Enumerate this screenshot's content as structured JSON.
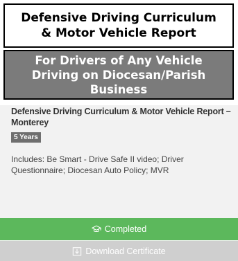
{
  "banner": {
    "title_line1": "Defensive Driving Curriculum",
    "title_line2": "& Motor Vehicle Report",
    "subtitle": "For Drivers of Any Vehicle Driving on Diocesan/Parish Business"
  },
  "course": {
    "title": "Defensive Driving Curriculum & Motor Vehicle Report – Monterey",
    "duration_badge": "5 Years",
    "includes": "Includes: Be Smart - Drive Safe II video; Driver Questionnaire; Diocesan Auto Policy; MVR"
  },
  "actions": {
    "completed_label": "Completed",
    "completed_icon": "graduation-cap-icon",
    "download_label": "Download Certificate",
    "download_icon": "download-icon"
  },
  "colors": {
    "completed_bg": "#5cb85c",
    "download_bg": "#cfcfcf",
    "badge_bg": "#6f6f6f",
    "banner_subtitle_bg": "#7b7b7b"
  }
}
